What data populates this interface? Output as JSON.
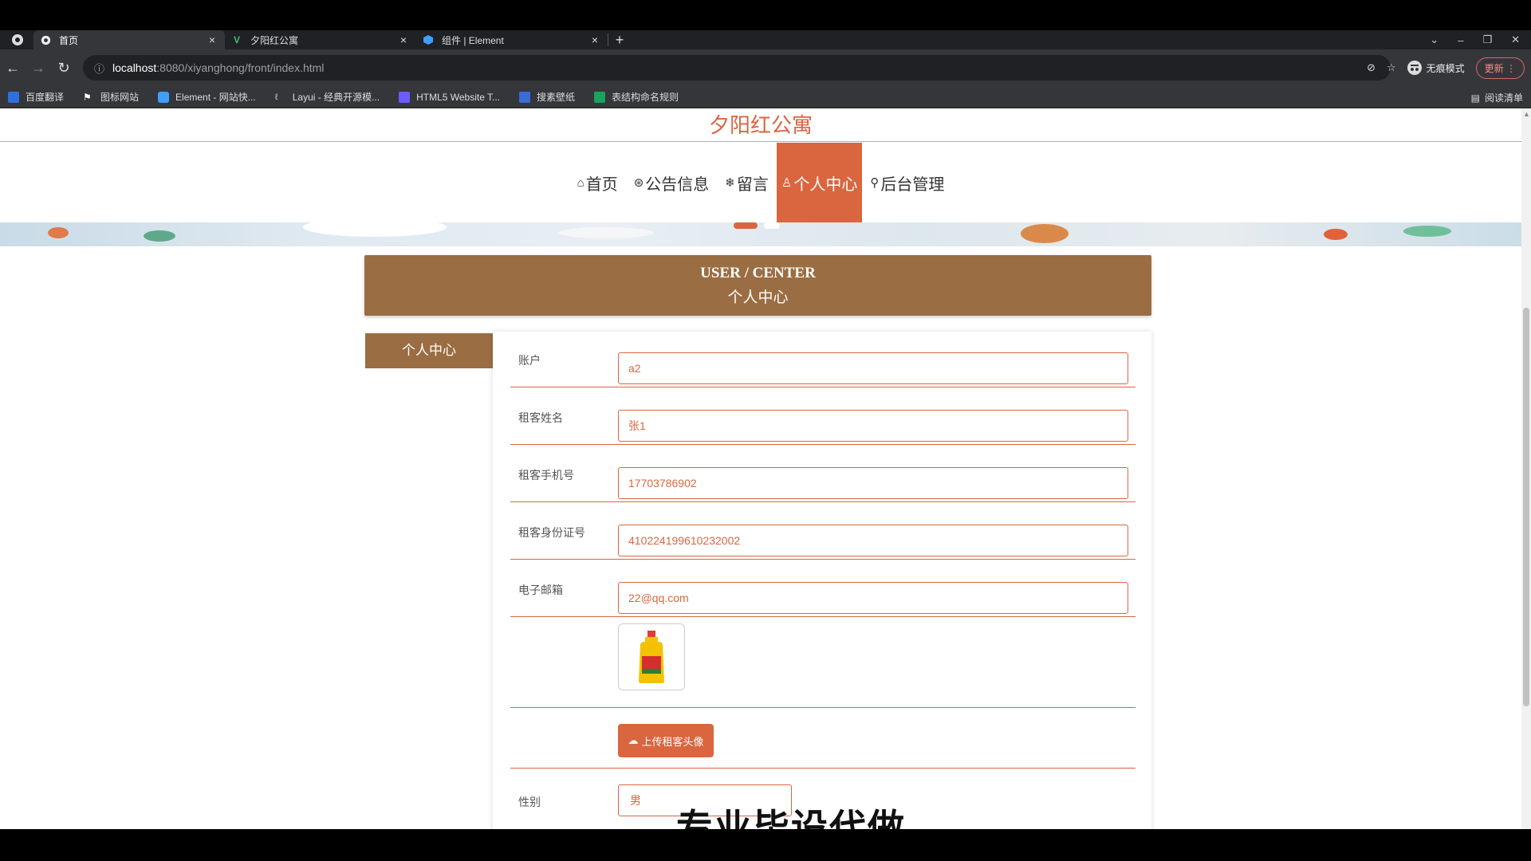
{
  "browser": {
    "tabs": [
      {
        "title": "首页",
        "active": true
      },
      {
        "title": "夕阳红公寓",
        "active": false
      },
      {
        "title": "组件 | Element",
        "active": false
      }
    ],
    "new_tab": "+",
    "close": "×",
    "url_host": "localhost",
    "url_rest": ":8080/xiyanghong/front/index.html",
    "incognito_label": "无痕模式",
    "update_label": "更新",
    "bookmarks": [
      {
        "label": "百度翻译",
        "color": "#2f6fe0"
      },
      {
        "label": "图标网站",
        "color": "#ffffff"
      },
      {
        "label": "Element - 网站快...",
        "color": "#409eff"
      },
      {
        "label": "Layui - 经典开源模...",
        "color": "#cccccc"
      },
      {
        "label": "HTML5 Website T...",
        "color": "#6b5cff"
      },
      {
        "label": "搜素壁纸",
        "color": "#3a6bd8"
      },
      {
        "label": "表结构命名规则",
        "color": "#1aa35c"
      }
    ],
    "reading_list": "阅读清单"
  },
  "site": {
    "title": "夕阳红公寓",
    "accent": "#d9663f",
    "brown": "#9b6d42",
    "nav": [
      {
        "label": "首页",
        "icon": "⌂",
        "active": false
      },
      {
        "label": "公告信息",
        "icon": "⊛",
        "active": false
      },
      {
        "label": "留言",
        "icon": "❄",
        "active": false
      },
      {
        "label": "个人中心",
        "icon": "♙",
        "active": true
      },
      {
        "label": "后台管理",
        "icon": "⚲",
        "active": false
      }
    ]
  },
  "header": {
    "en": "USER / CENTER",
    "zh": "个人中心"
  },
  "sidebar": {
    "tab": "个人中心"
  },
  "form": {
    "account_label": "账户",
    "account_value": "a2",
    "name_label": "租客姓名",
    "name_value": "张1",
    "phone_label": "租客手机号",
    "phone_value": "17703786902",
    "id_label": "租客身份证号",
    "id_value": "410224199610232002",
    "email_label": "电子邮箱",
    "email_value": "22@qq.com",
    "upload_label": "上传租客头像",
    "gender_label": "性别",
    "gender_value": "男"
  },
  "overlay_text": "专业毕设代做"
}
